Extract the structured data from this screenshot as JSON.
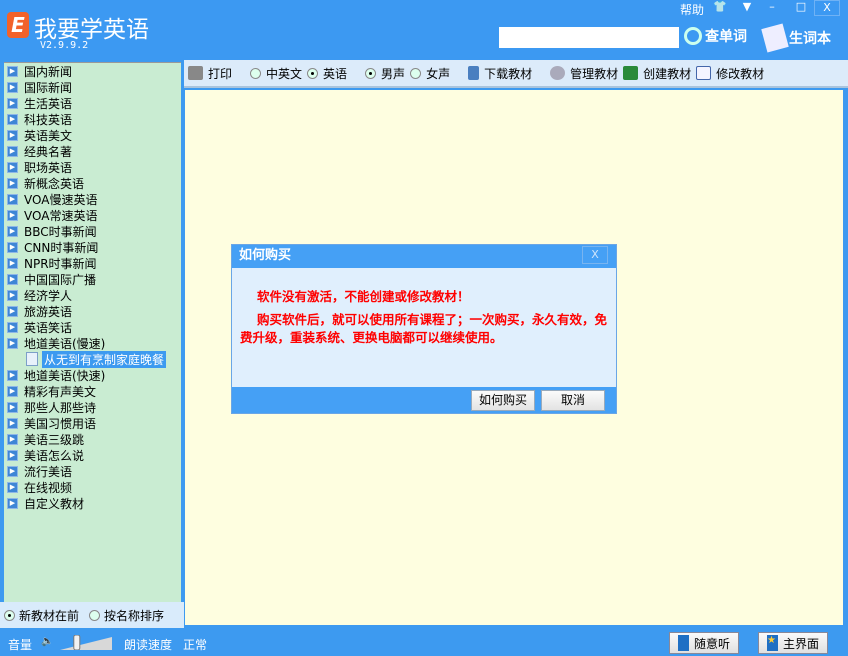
{
  "app": {
    "logo_letter": "E",
    "title": "我要学英语",
    "version": "V2.9.9.2"
  },
  "header": {
    "help": "帮助",
    "min": "–",
    "max": "□",
    "close": "X",
    "search_value": "",
    "lookup": "查单词",
    "vocab": "生词本"
  },
  "sidebar": {
    "items": [
      "国内新闻",
      "国际新闻",
      "生活英语",
      "科技英语",
      "英语美文",
      "经典名著",
      "职场英语",
      "新概念英语",
      "VOA慢速英语",
      "VOA常速英语",
      "BBC时事新闻",
      "CNN时事新闻",
      "NPR时事新闻",
      "中国国际广播",
      "经济学人",
      "旅游英语",
      "英语笑话",
      "地道美语(慢速)"
    ],
    "child": "从无到有烹制家庭晚餐",
    "items2": [
      "地道美语(快速)",
      "精彩有声美文",
      "那些人那些诗",
      "美国习惯用语",
      "美语三级跳",
      "美语怎么说",
      "流行美语",
      "在线视频",
      "自定义教材"
    ],
    "sort_new": "新教材在前",
    "sort_name": "按名称排序"
  },
  "toolbar": {
    "print": "打印",
    "bilingual": "中英文",
    "english": "英语",
    "male": "男声",
    "female": "女声",
    "download": "下载教材",
    "manage": "管理教材",
    "create": "创建教材",
    "edit": "修改教材"
  },
  "dialog": {
    "title": "如何购买",
    "close": "X",
    "line1": "软件没有激活，不能创建或修改教材！",
    "line2": "购买软件后，就可以使用所有课程了；一次购买，永久有效，免费升级，重装系统、更换电脑都可以继续使用。",
    "buy": "如何购买",
    "cancel": "取消"
  },
  "bottom": {
    "volume": "音量",
    "speed_label": "朗读速度",
    "speed": "正常",
    "volume_level": 0.3,
    "random": "随意听",
    "home": "主界面"
  }
}
